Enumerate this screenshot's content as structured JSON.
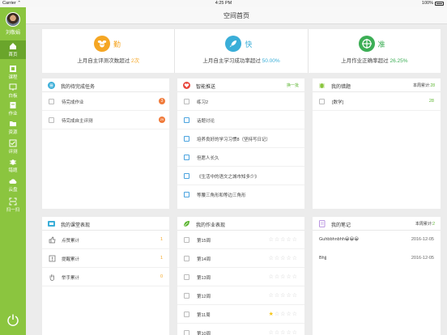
{
  "status_bar": {
    "carrier": "Carrier ⌃",
    "time": "4:25 PM",
    "battery": "100%"
  },
  "user": {
    "name": "刘敬娟"
  },
  "nav": [
    {
      "label": "首页",
      "icon": "home-icon"
    },
    {
      "label": "课程",
      "icon": "course-icon"
    },
    {
      "label": "白板",
      "icon": "whiteboard-icon"
    },
    {
      "label": "作业",
      "icon": "homework-icon"
    },
    {
      "label": "资源",
      "icon": "resource-icon"
    },
    {
      "label": "评测",
      "icon": "assessment-icon"
    },
    {
      "label": "错题",
      "icon": "wrong-questions-icon"
    },
    {
      "label": "云盘",
      "icon": "cloud-disk-icon"
    },
    {
      "label": "扫一扫",
      "icon": "scan-icon"
    }
  ],
  "header": {
    "title": "空间首页"
  },
  "stats": [
    {
      "word": "勤",
      "caption_pre": "上月自主评测次数超过 ",
      "value": "2次",
      "color": "#f5a623",
      "icon": "bee-icon"
    },
    {
      "word": "快",
      "caption_pre": "上月自主学习成功率超过 ",
      "value": "50.00%",
      "color": "#3aaed8",
      "icon": "rocket-icon"
    },
    {
      "word": "准",
      "caption_pre": "上月作业正确率超过 ",
      "value": "26.25%",
      "color": "#3cae55",
      "icon": "target-icon"
    }
  ],
  "tasks": {
    "title": "我的待完成任务",
    "items": [
      {
        "label": "待完成作业",
        "count": "3",
        "color": "#f07a3a"
      },
      {
        "label": "待完成自主评测",
        "count": "29",
        "color": "#f07a3a"
      }
    ]
  },
  "recommend": {
    "title": "智能推送",
    "action": "换一批",
    "items": [
      {
        "label": "练习2",
        "icon": "doc"
      },
      {
        "label": "话题讨论",
        "icon": "video"
      },
      {
        "label": "培养良好的学习习惯8（坚持写日记）",
        "icon": "video"
      },
      {
        "label": "但愿人长久",
        "icon": "video"
      },
      {
        "label": "《生活中的语文之城市知多少》",
        "icon": "video"
      },
      {
        "label": "等腰三角形和等边三角形",
        "icon": "video"
      }
    ]
  },
  "wrong": {
    "title": "我的错题",
    "total_label": "本周累计:",
    "total": "28",
    "items": [
      {
        "label": "[数学]",
        "count": "28"
      }
    ]
  },
  "classroom": {
    "title": "我的课堂表现",
    "items": [
      {
        "label": "点赞累计",
        "count": "1",
        "icon": "thumbs-up-icon"
      },
      {
        "label": "提醒累计",
        "count": "1",
        "icon": "alert-icon"
      },
      {
        "label": "举手累计",
        "count": "0",
        "icon": "raise-hand-icon"
      }
    ]
  },
  "homework": {
    "title": "我的作业表现",
    "items": [
      {
        "label": "第15周",
        "stars": 0
      },
      {
        "label": "第14周",
        "stars": 0
      },
      {
        "label": "第13周",
        "stars": 0
      },
      {
        "label": "第12周",
        "stars": 0
      },
      {
        "label": "第11周",
        "stars": 1
      },
      {
        "label": "第10周",
        "stars": 0
      }
    ]
  },
  "notes": {
    "title": "我的笔记",
    "total_label": "本周累计:",
    "total": "2",
    "items": [
      {
        "label": "Guhbbhnbhh😀😀😀",
        "date": "2016-12-05"
      },
      {
        "label": "Bhjj",
        "date": "2016-12-05"
      }
    ]
  },
  "colors": {
    "sidebar": "#8bc53f",
    "sidebar_active": "#6aa52b",
    "accent_green": "#5cb531"
  }
}
